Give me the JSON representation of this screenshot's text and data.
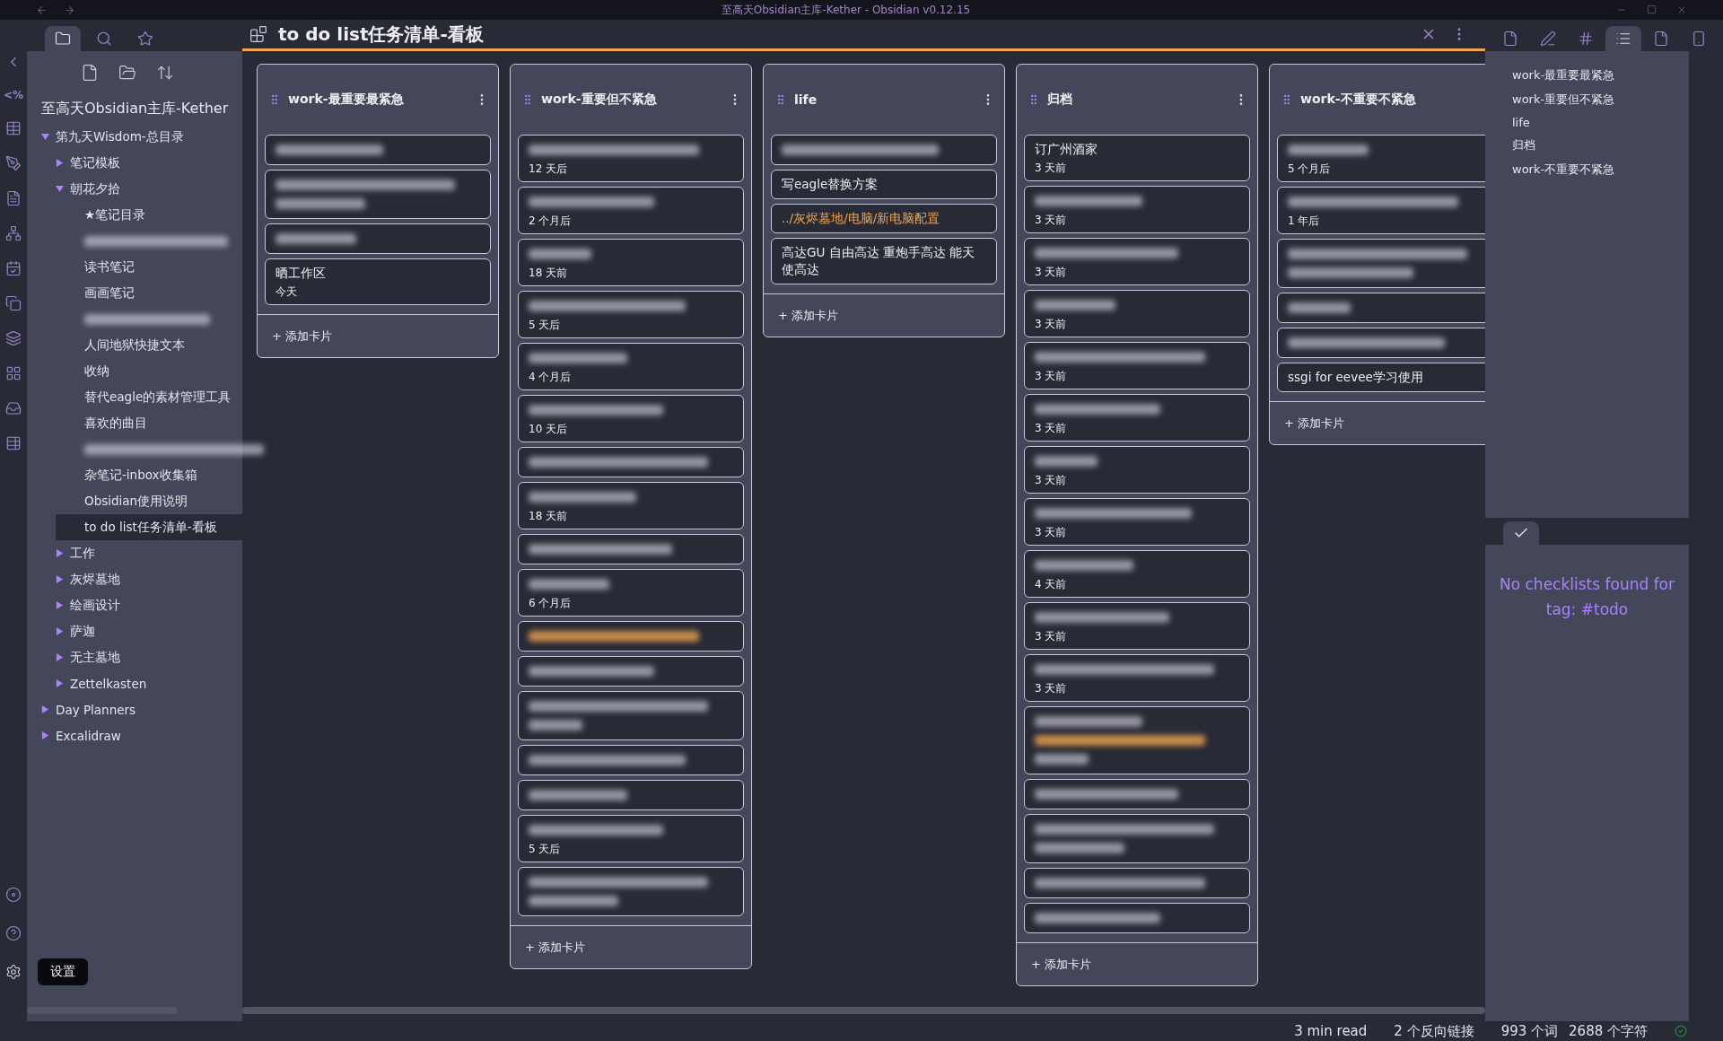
{
  "window": {
    "title": "至高天Obsidian主库-Kether - Obsidian v0.12.15"
  },
  "ribbon": {
    "template_glyph": "<%",
    "tooltip": "设置"
  },
  "left_tabs": [
    {
      "selected": true
    },
    {
      "selected": false
    },
    {
      "selected": false
    }
  ],
  "file_tree": {
    "vault": "至高天Obsidian主库-Kether",
    "items": [
      {
        "kind": "folder",
        "name": "第九天Wisdom-总目录",
        "expanded": true,
        "children": [
          {
            "kind": "folder",
            "name": "笔记模板",
            "expanded": false
          },
          {
            "kind": "folder",
            "name": "朝花夕拾",
            "expanded": true,
            "children": [
              {
                "kind": "file",
                "name": "★笔记目录",
                "selected": false
              },
              {
                "kind": "redacted",
                "selected": false
              },
              {
                "kind": "file",
                "name": "读书笔记",
                "selected": false
              },
              {
                "kind": "file",
                "name": "画画笔记",
                "selected": false
              },
              {
                "kind": "redacted",
                "selected": false
              },
              {
                "kind": "file",
                "name": "人间地狱快捷文本",
                "selected": false
              },
              {
                "kind": "file",
                "name": "收纳",
                "selected": false
              },
              {
                "kind": "file",
                "name": "替代eagle的素材管理工具",
                "selected": false
              },
              {
                "kind": "file",
                "name": "喜欢的曲目",
                "selected": false
              },
              {
                "kind": "redacted",
                "selected": false
              },
              {
                "kind": "file",
                "name": "杂笔记-inbox收集箱",
                "selected": false
              },
              {
                "kind": "file",
                "name": "Obsidian使用说明",
                "selected": false
              },
              {
                "kind": "file",
                "name": "to do list任务清单-看板",
                "selected": true
              }
            ]
          },
          {
            "kind": "folder",
            "name": "工作",
            "expanded": false
          },
          {
            "kind": "folder",
            "name": "灰烬墓地",
            "expanded": false
          },
          {
            "kind": "folder",
            "name": "绘画设计",
            "expanded": false
          },
          {
            "kind": "folder",
            "name": "萨迦",
            "expanded": false
          },
          {
            "kind": "folder",
            "name": "无主墓地",
            "expanded": false
          },
          {
            "kind": "folder",
            "name": "Zettelkasten",
            "expanded": false
          }
        ]
      },
      {
        "kind": "folder",
        "name": "Day Planners",
        "expanded": false
      },
      {
        "kind": "folder",
        "name": "Excalidraw",
        "expanded": false
      }
    ]
  },
  "view": {
    "title": "to do list任务清单-看板"
  },
  "board": {
    "lanes": [
      {
        "title": "work-最重要最紧急",
        "menu": true,
        "add_label": "+ 添加卡片",
        "cards": [
          {
            "kind": "redacted"
          },
          {
            "kind": "redacted_multi"
          },
          {
            "kind": "redacted"
          },
          {
            "kind": "text",
            "text": "晒工作区",
            "meta": "今天"
          }
        ]
      },
      {
        "title": "work-重要但不紧急",
        "menu": true,
        "add_label": "+ 添加卡片",
        "cards": [
          {
            "kind": "redacted",
            "meta": "12 天后"
          },
          {
            "kind": "redacted",
            "meta": "2 个月后"
          },
          {
            "kind": "redacted",
            "meta": "18 天前"
          },
          {
            "kind": "redacted",
            "meta": "5 天后"
          },
          {
            "kind": "redacted",
            "meta": "4 个月后"
          },
          {
            "kind": "redacted",
            "meta": "10 天后"
          },
          {
            "kind": "redacted"
          },
          {
            "kind": "redacted",
            "meta": "18 天前"
          },
          {
            "kind": "redacted"
          },
          {
            "kind": "redacted",
            "meta": "6 个月后"
          },
          {
            "kind": "redacted_link"
          },
          {
            "kind": "redacted"
          },
          {
            "kind": "redacted_multi"
          },
          {
            "kind": "redacted"
          },
          {
            "kind": "redacted"
          },
          {
            "kind": "redacted",
            "meta": "5 天后"
          },
          {
            "kind": "redacted_multi"
          }
        ]
      },
      {
        "title": "life",
        "menu": true,
        "add_label": "+ 添加卡片",
        "cards": [
          {
            "kind": "redacted"
          },
          {
            "kind": "text",
            "text": "写eagle替换方案"
          },
          {
            "kind": "link",
            "text": "../灰烬墓地/电脑/新电脑配置"
          },
          {
            "kind": "text",
            "text": "高达GU 自由高达 重炮手高达 能天使高达"
          }
        ]
      },
      {
        "title": "归档",
        "menu": true,
        "add_label": "+ 添加卡片",
        "cards": [
          {
            "kind": "text",
            "text": "订广州酒家",
            "meta": "3 天前"
          },
          {
            "kind": "redacted",
            "meta": "3 天前"
          },
          {
            "kind": "redacted",
            "meta": "3 天前"
          },
          {
            "kind": "redacted",
            "meta": "3 天前"
          },
          {
            "kind": "redacted",
            "meta": "3 天前"
          },
          {
            "kind": "redacted",
            "meta": "3 天前"
          },
          {
            "kind": "redacted",
            "meta": "3 天前"
          },
          {
            "kind": "redacted",
            "meta": "3 天前"
          },
          {
            "kind": "redacted",
            "meta": "4 天前"
          },
          {
            "kind": "redacted",
            "meta": "3 天前"
          },
          {
            "kind": "redacted",
            "meta": "3 天前"
          },
          {
            "kind": "redacted_link"
          },
          {
            "kind": "redacted"
          },
          {
            "kind": "redacted_multi"
          },
          {
            "kind": "redacted"
          },
          {
            "kind": "redacted"
          }
        ]
      },
      {
        "title": "work-不重要不紧急",
        "menu": false,
        "add_label": "+ 添加卡片",
        "cards": [
          {
            "kind": "redacted",
            "meta": "5 个月后"
          },
          {
            "kind": "redacted",
            "meta": "1 年后"
          },
          {
            "kind": "redacted_multi"
          },
          {
            "kind": "redacted"
          },
          {
            "kind": "redacted"
          },
          {
            "kind": "text",
            "text": "ssgi for eevee学习使用"
          }
        ]
      }
    ]
  },
  "right_tabs": [
    {
      "selected": false
    },
    {
      "selected": false
    },
    {
      "selected": false
    },
    {
      "selected": true
    },
    {
      "selected": false
    },
    {
      "selected": false
    }
  ],
  "outline": [
    "work-最重要最紧急",
    "work-重要但不紧急",
    "life",
    "归档",
    "work-不重要不紧急"
  ],
  "checklist": {
    "message": "No checklists found for tag: #todo"
  },
  "status_bar": {
    "read_time": "3 min read",
    "backlinks": "2 个反向链接",
    "words": "993 个词",
    "characters": "2688 个字符"
  }
}
